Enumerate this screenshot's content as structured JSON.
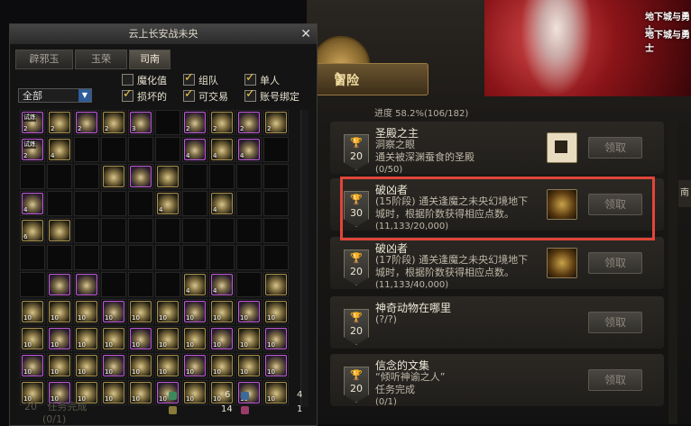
{
  "inventory": {
    "title": "云上长安战未央",
    "close": "✕",
    "tabs": [
      "辟邪玉",
      "玉荣",
      "司南"
    ],
    "active_tab": 2,
    "filter_value": "全部",
    "checks": [
      {
        "label": "魔化值",
        "checked": false
      },
      {
        "label": "组队",
        "checked": true
      },
      {
        "label": "单人",
        "checked": true
      },
      {
        "label": "损坏的",
        "checked": true
      },
      {
        "label": "可交易",
        "checked": true
      },
      {
        "label": "账号绑定",
        "checked": true
      }
    ],
    "items": [
      {
        "r": 0,
        "c": 0,
        "t": "purple",
        "q": "2",
        "tag": "试炼"
      },
      {
        "r": 0,
        "c": 1,
        "t": "gold",
        "q": "2"
      },
      {
        "r": 0,
        "c": 2,
        "t": "purple",
        "q": "2"
      },
      {
        "r": 0,
        "c": 3,
        "t": "gold",
        "q": "2"
      },
      {
        "r": 0,
        "c": 4,
        "t": "purple",
        "q": "3"
      },
      {
        "r": 0,
        "c": 6,
        "t": "purple",
        "q": "2"
      },
      {
        "r": 0,
        "c": 7,
        "t": "gold",
        "q": "2"
      },
      {
        "r": 0,
        "c": 8,
        "t": "purple",
        "q": "2"
      },
      {
        "r": 0,
        "c": 9,
        "t": "gold",
        "q": "2"
      },
      {
        "r": 1,
        "c": 0,
        "t": "purple",
        "q": "2",
        "tag": "试炼"
      },
      {
        "r": 1,
        "c": 1,
        "t": "gold",
        "q": "4"
      },
      {
        "r": 1,
        "c": 6,
        "t": "purple",
        "q": "4"
      },
      {
        "r": 1,
        "c": 7,
        "t": "gold",
        "q": "4"
      },
      {
        "r": 1,
        "c": 8,
        "t": "purple",
        "q": "4"
      },
      {
        "r": 2,
        "c": 3,
        "t": "gold",
        "q": ""
      },
      {
        "r": 2,
        "c": 4,
        "t": "purple",
        "q": ""
      },
      {
        "r": 2,
        "c": 5,
        "t": "gold",
        "q": ""
      },
      {
        "r": 3,
        "c": 0,
        "t": "purple",
        "q": "4"
      },
      {
        "r": 3,
        "c": 5,
        "t": "gold",
        "q": "4"
      },
      {
        "r": 3,
        "c": 7,
        "t": "gold",
        "q": "4"
      },
      {
        "r": 4,
        "c": 0,
        "t": "gold",
        "q": "6"
      },
      {
        "r": 4,
        "c": 1,
        "t": "gold",
        "q": ""
      },
      {
        "r": 6,
        "c": 1,
        "t": "purple",
        "q": ""
      },
      {
        "r": 6,
        "c": 2,
        "t": "purple",
        "q": ""
      },
      {
        "r": 6,
        "c": 6,
        "t": "gold",
        "q": "4"
      },
      {
        "r": 6,
        "c": 7,
        "t": "purple",
        "q": "4"
      },
      {
        "r": 6,
        "c": 9,
        "t": "gold",
        "q": ""
      },
      {
        "r": 7,
        "c": 0,
        "t": "gold",
        "q": "10"
      },
      {
        "r": 7,
        "c": 1,
        "t": "gold",
        "q": "10"
      },
      {
        "r": 7,
        "c": 2,
        "t": "gold",
        "q": "10"
      },
      {
        "r": 7,
        "c": 3,
        "t": "purple",
        "q": "10"
      },
      {
        "r": 7,
        "c": 4,
        "t": "gold",
        "q": "10"
      },
      {
        "r": 7,
        "c": 5,
        "t": "gold",
        "q": "10"
      },
      {
        "r": 7,
        "c": 6,
        "t": "purple",
        "q": "10"
      },
      {
        "r": 7,
        "c": 7,
        "t": "gold",
        "q": "10"
      },
      {
        "r": 7,
        "c": 8,
        "t": "purple",
        "q": "10"
      },
      {
        "r": 7,
        "c": 9,
        "t": "gold",
        "q": "10"
      },
      {
        "r": 8,
        "c": 0,
        "t": "gold",
        "q": "10"
      },
      {
        "r": 8,
        "c": 1,
        "t": "purple",
        "q": "10"
      },
      {
        "r": 8,
        "c": 2,
        "t": "gold",
        "q": "10"
      },
      {
        "r": 8,
        "c": 3,
        "t": "gold",
        "q": "10"
      },
      {
        "r": 8,
        "c": 4,
        "t": "purple",
        "q": "10"
      },
      {
        "r": 8,
        "c": 5,
        "t": "gold",
        "q": "10"
      },
      {
        "r": 8,
        "c": 6,
        "t": "gold",
        "q": "10"
      },
      {
        "r": 8,
        "c": 7,
        "t": "purple",
        "q": "10"
      },
      {
        "r": 8,
        "c": 8,
        "t": "gold",
        "q": "10"
      },
      {
        "r": 8,
        "c": 9,
        "t": "purple",
        "q": "10"
      },
      {
        "r": 9,
        "c": 0,
        "t": "purple",
        "q": "10"
      },
      {
        "r": 9,
        "c": 1,
        "t": "gold",
        "q": "10"
      },
      {
        "r": 9,
        "c": 2,
        "t": "gold",
        "q": "10"
      },
      {
        "r": 9,
        "c": 3,
        "t": "purple",
        "q": "10"
      },
      {
        "r": 9,
        "c": 4,
        "t": "gold",
        "q": "10"
      },
      {
        "r": 9,
        "c": 5,
        "t": "gold",
        "q": "10"
      },
      {
        "r": 9,
        "c": 6,
        "t": "purple",
        "q": "10"
      },
      {
        "r": 9,
        "c": 7,
        "t": "gold",
        "q": "10"
      },
      {
        "r": 9,
        "c": 8,
        "t": "gold",
        "q": "10"
      },
      {
        "r": 9,
        "c": 9,
        "t": "purple",
        "q": "10"
      },
      {
        "r": 10,
        "c": 0,
        "t": "gold",
        "q": "10"
      },
      {
        "r": 10,
        "c": 1,
        "t": "purple",
        "q": "10"
      },
      {
        "r": 10,
        "c": 2,
        "t": "gold",
        "q": "10"
      },
      {
        "r": 10,
        "c": 3,
        "t": "gold",
        "q": "10"
      },
      {
        "r": 10,
        "c": 4,
        "t": "gold",
        "q": "10"
      },
      {
        "r": 10,
        "c": 5,
        "t": "purple",
        "q": "10"
      },
      {
        "r": 10,
        "c": 6,
        "t": "gold",
        "q": "10"
      },
      {
        "r": 10,
        "c": 7,
        "t": "gold",
        "q": "10"
      },
      {
        "r": 10,
        "c": 8,
        "t": "purple",
        "q": "10"
      },
      {
        "r": 10,
        "c": 9,
        "t": "gold",
        "q": "10"
      }
    ],
    "counts": [
      "6",
      "4",
      "14",
      "1"
    ],
    "hidden_footer": "任务完成",
    "hidden_footer_value": "(0/1)",
    "hidden_badge": "20"
  },
  "achievements": {
    "progress": "进度 58.2%(106/182)",
    "tab_label": "冒险",
    "side_label": "南",
    "claim_label": "领取",
    "banner_logo": "地下城与勇士",
    "list": [
      {
        "points": "20",
        "title": "圣殿之主",
        "desc": "洞察之眼",
        "desc2": "通关被深渊蚕食的圣殿",
        "progress": "(0/50)"
      },
      {
        "points": "30",
        "title": "破凶者",
        "desc": "(15阶段) 通关逢魔之未央幻境地下",
        "desc2": "城时，根据阶数获得相应点数。",
        "progress": "(11,133/20,000)"
      },
      {
        "points": "20",
        "title": "破凶者",
        "desc": "(17阶段) 通关逢魔之未央幻境地下",
        "desc2": "城时，根据阶数获得相应点数。",
        "progress": "(11,133/40,000)"
      },
      {
        "points": "20",
        "title": "神奇动物在哪里",
        "desc": "(?/?)",
        "desc2": "",
        "progress": ""
      },
      {
        "points": "20",
        "title": "信念的文集",
        "desc": "“倾听神谕之人”",
        "desc2": "任务完成",
        "progress": "(0/1)"
      }
    ]
  }
}
